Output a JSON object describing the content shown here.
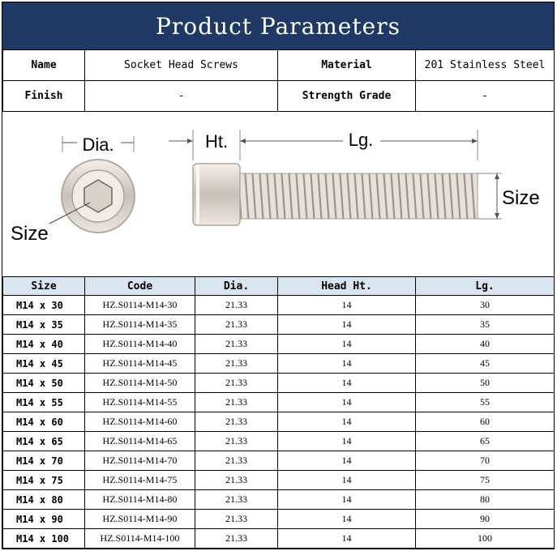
{
  "title": "Product Parameters",
  "info": {
    "name_label": "Name",
    "name_value": "Socket Head Screws",
    "material_label": "Material",
    "material_value": "201 Stainless Steel",
    "finish_label": "Finish",
    "finish_value": "-",
    "grade_label": "Strength Grade",
    "grade_value": "-"
  },
  "diagram": {
    "dia_label": "Dia.",
    "ht_label": "Ht.",
    "lg_label": "Lg.",
    "size_label_left": "Size",
    "size_label_right": "Size"
  },
  "table": {
    "headers": [
      "Size",
      "Code",
      "Dia.",
      "Head Ht.",
      "Lg."
    ],
    "rows": [
      [
        "M14 x 30",
        "HZ.S0114-M14-30",
        "21.33",
        "14",
        "30"
      ],
      [
        "M14 x 35",
        "HZ.S0114-M14-35",
        "21.33",
        "14",
        "35"
      ],
      [
        "M14 x 40",
        "HZ.S0114-M14-40",
        "21.33",
        "14",
        "40"
      ],
      [
        "M14 x 45",
        "HZ.S0114-M14-45",
        "21.33",
        "14",
        "45"
      ],
      [
        "M14 x 50",
        "HZ.S0114-M14-50",
        "21.33",
        "14",
        "50"
      ],
      [
        "M14 x 55",
        "HZ.S0114-M14-55",
        "21.33",
        "14",
        "55"
      ],
      [
        "M14 x 60",
        "HZ.S0114-M14-60",
        "21.33",
        "14",
        "60"
      ],
      [
        "M14 x 65",
        "HZ.S0114-M14-65",
        "21.33",
        "14",
        "65"
      ],
      [
        "M14 x 70",
        "HZ.S0114-M14-70",
        "21.33",
        "14",
        "70"
      ],
      [
        "M14 x 75",
        "HZ.S0114-M14-75",
        "21.33",
        "14",
        "75"
      ],
      [
        "M14 x 80",
        "HZ.S0114-M14-80",
        "21.33",
        "14",
        "80"
      ],
      [
        "M14 x 90",
        "HZ.S0114-M14-90",
        "21.33",
        "14",
        "90"
      ],
      [
        "M14 x 100",
        "HZ.S0114-M14-100",
        "21.33",
        "14",
        "100"
      ]
    ]
  }
}
